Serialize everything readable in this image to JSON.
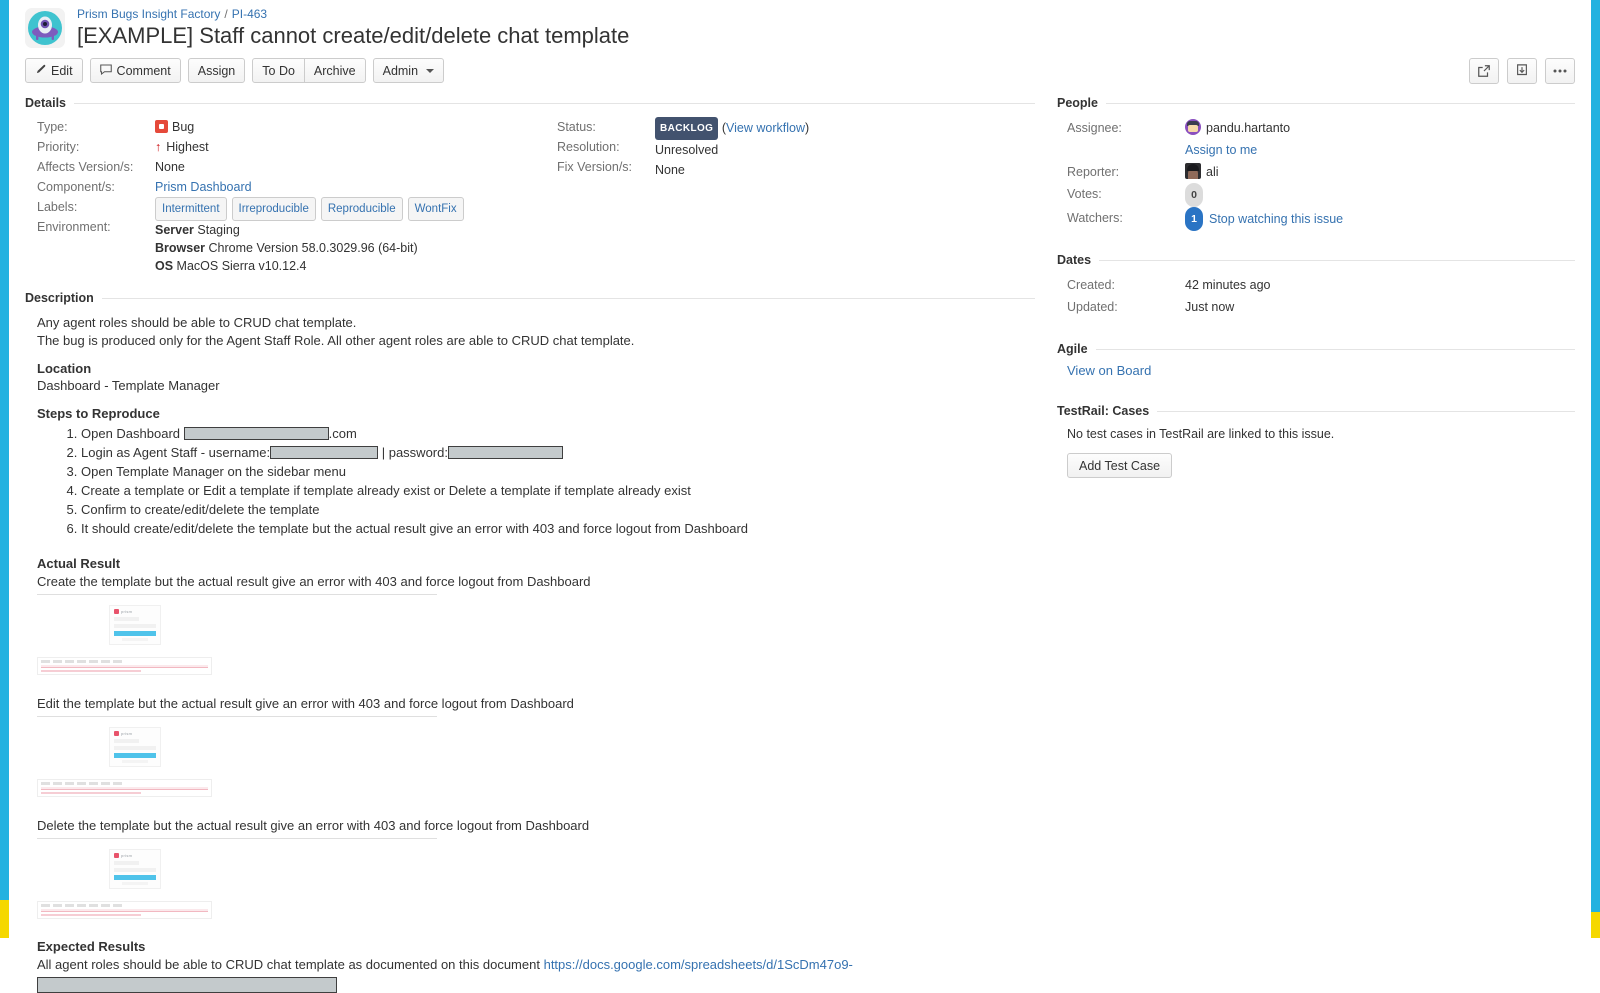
{
  "header": {
    "project_breadcrumb": "Prism Bugs Insight Factory",
    "breadcrumb_separator": "/",
    "issue_key": "PI-463",
    "issue_title": "[EXAMPLE] Staff cannot create/edit/delete chat template",
    "project_avatar_icon": "ufo-avatar-icon"
  },
  "toolbar": {
    "edit_label": "Edit",
    "edit_icon": "pencil-icon",
    "comment_label": "Comment",
    "comment_icon": "speech-bubble-icon",
    "assign_label": "Assign",
    "todo_label": "To Do",
    "archive_label": "Archive",
    "admin_label": "Admin",
    "admin_caret_icon": "chevron-down-icon",
    "share_icon": "share-icon",
    "export_icon": "export-download-icon",
    "more_icon": "ellipsis-icon"
  },
  "details": {
    "section_title": "Details",
    "left_fields": [
      {
        "label": "Type:",
        "value": "Bug"
      },
      {
        "label": "Priority:",
        "value": "Highest"
      },
      {
        "label": "Affects Version/s:",
        "value": "None"
      },
      {
        "label": "Component/s:",
        "value": "Prism Dashboard"
      },
      {
        "label": "Labels:",
        "value": ""
      },
      {
        "label": "Environment:",
        "value": ""
      }
    ],
    "type_value": "Bug",
    "priority_value": "Highest",
    "affects_version_value": "None",
    "component_value": "Prism Dashboard",
    "labels": [
      "Intermittent",
      "Irreproducible",
      "Reproducible",
      "WontFix"
    ],
    "environment": [
      {
        "key": "Server",
        "value": "Staging"
      },
      {
        "key": "Browser",
        "value": "Chrome Version 58.0.3029.96 (64-bit)"
      },
      {
        "key": "OS",
        "value": "MacOS Sierra v10.12.4"
      }
    ],
    "right_fields": {
      "status_label": "Status:",
      "status_value": "BACKLOG",
      "status_color": "#42526e",
      "view_workflow": "View workflow",
      "resolution_label": "Resolution:",
      "resolution_value": "Unresolved",
      "fix_version_label": "Fix Version/s:",
      "fix_version_value": "None"
    }
  },
  "description": {
    "section_title": "Description",
    "intro_line_1": "Any agent roles should be able to CRUD chat template.",
    "intro_line_2": "The bug is produced only for the Agent Staff Role. All other agent roles are able to CRUD chat template.",
    "location_heading": "Location",
    "location_value": "Dashboard - Template Manager",
    "steps_heading": "Steps to Reproduce",
    "step_1_prefix": "Open Dashboard",
    "step_1_suffix": ".com",
    "step_2_prefix": "Login as Agent Staff - username:",
    "step_2_middle": "| password:",
    "step_3": "Open Template Manager on the sidebar menu",
    "step_4": "Create a template or Edit a template if template already exist or Delete a template if template already exist",
    "step_5": "Confirm to create/edit/delete the template",
    "step_6": "It should create/edit/delete the template but the actual result give an error with 403 and force logout from Dashboard",
    "actual_result_heading": "Actual Result",
    "actual_create": "Create the template but the actual result give an error with 403 and force logout from Dashboard",
    "actual_edit": "Edit the template but the actual result give an error with 403 and force logout from Dashboard",
    "actual_delete": "Delete the template but the actual result give an error with 403 and force logout from Dashboard",
    "expected_heading": "Expected Results",
    "expected_text": "All agent roles should be able to CRUD chat template as documented on this document",
    "expected_link": "https://docs.google.com/spreadsheets/d/1ScDm47o9-",
    "thumbnail_logo_text": "prism"
  },
  "people": {
    "section_title": "People",
    "assignee_label": "Assignee:",
    "assignee_value": "pandu.hartanto",
    "assign_to_me": "Assign to me",
    "reporter_label": "Reporter:",
    "reporter_value": "ali",
    "votes_label": "Votes:",
    "votes_value": "0",
    "watchers_label": "Watchers:",
    "watchers_value": "1",
    "watchers_action": "Stop watching this issue"
  },
  "dates": {
    "section_title": "Dates",
    "created_label": "Created:",
    "created_value": "42 minutes ago",
    "updated_label": "Updated:",
    "updated_value": "Just now"
  },
  "agile": {
    "section_title": "Agile",
    "view_on_board": "View on Board"
  },
  "testrail": {
    "section_title": "TestRail: Cases",
    "empty_message": "No test cases in TestRail are linked to this issue.",
    "add_button": "Add Test Case"
  }
}
